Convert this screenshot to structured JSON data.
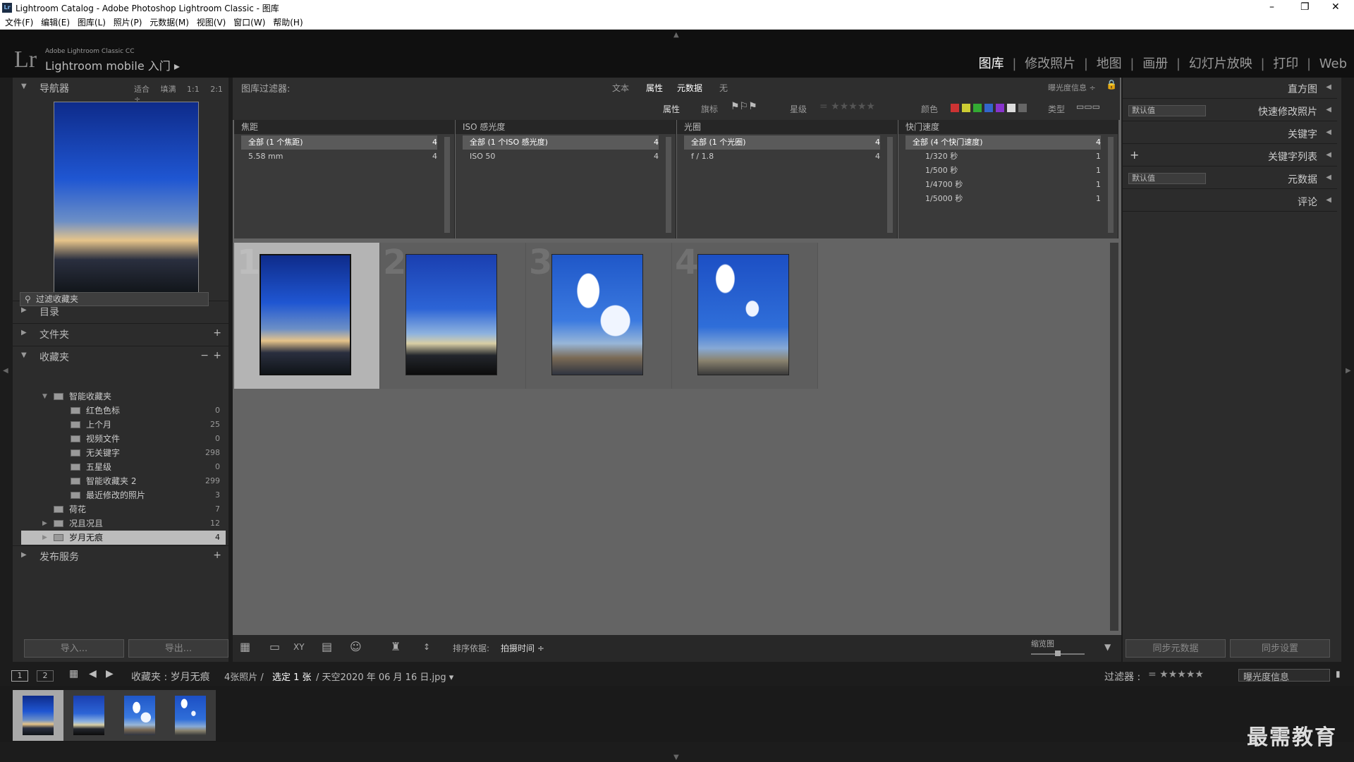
{
  "window": {
    "title": "Lightroom Catalog - Adobe Photoshop Lightroom Classic - 图库"
  },
  "menu": [
    "文件(F)",
    "编辑(E)",
    "图库(L)",
    "照片(P)",
    "元数据(M)",
    "视图(V)",
    "窗口(W)",
    "帮助(H)"
  ],
  "identity": {
    "brand_small": "Adobe Lightroom Classic CC",
    "brand_main": "Lightroom mobile 入门 ▸",
    "lr": "Lr"
  },
  "modules": [
    "图库",
    "修改照片",
    "地图",
    "画册",
    "幻灯片放映",
    "打印",
    "Web"
  ],
  "navigator": {
    "title": "导航器",
    "modes": [
      "适合",
      "填满",
      "1:1",
      "2:1 ÷"
    ]
  },
  "left_panels": {
    "catalog": "目录",
    "folders": "文件夹",
    "collections": "收藏夹",
    "publish": "发布服务"
  },
  "collection_filter": "过滤收藏夹",
  "collections": [
    {
      "label": "智能收藏夹",
      "count": "",
      "indent": 1,
      "type": "set"
    },
    {
      "label": "红色色标",
      "count": "0",
      "indent": 2,
      "type": "smart"
    },
    {
      "label": "上个月",
      "count": "25",
      "indent": 2,
      "type": "smart"
    },
    {
      "label": "视频文件",
      "count": "0",
      "indent": 2,
      "type": "smart"
    },
    {
      "label": "无关键字",
      "count": "298",
      "indent": 2,
      "type": "smart"
    },
    {
      "label": "五星级",
      "count": "0",
      "indent": 2,
      "type": "smart"
    },
    {
      "label": "智能收藏夹 2",
      "count": "299",
      "indent": 2,
      "type": "smart"
    },
    {
      "label": "最近修改的照片",
      "count": "3",
      "indent": 2,
      "type": "smart"
    },
    {
      "label": "荷花",
      "count": "7",
      "indent": 1,
      "type": "coll"
    },
    {
      "label": "况且况且",
      "count": "12",
      "indent": 1,
      "type": "coll"
    },
    {
      "label": "岁月无痕",
      "count": "4",
      "indent": 1,
      "type": "coll"
    }
  ],
  "left_buttons": {
    "import": "导入...",
    "export": "导出..."
  },
  "filterbar": {
    "title": "图库过滤器:",
    "tabs": [
      "文本",
      "属性",
      "元数据",
      "无"
    ],
    "preset": "曝光度信息 ÷",
    "attr_label": "属性",
    "flag": "旗标",
    "rating": "星级",
    "color": "颜色",
    "kind": "类型"
  },
  "metadata_columns": [
    {
      "header": "焦距",
      "rows": [
        {
          "label": "全部 (1 个焦距)",
          "count": "4"
        },
        {
          "label": "5.58 mm",
          "count": "4"
        }
      ]
    },
    {
      "header": "ISO 感光度",
      "rows": [
        {
          "label": "全部 (1 个ISO 感光度)",
          "count": "4"
        },
        {
          "label": "ISO 50",
          "count": "4"
        }
      ]
    },
    {
      "header": "光圈",
      "rows": [
        {
          "label": "全部 (1 个光圈)",
          "count": "4"
        },
        {
          "label": "f / 1.8",
          "count": "4"
        }
      ]
    },
    {
      "header": "快门速度",
      "rows": [
        {
          "label": "全部 (4 个快门速度)",
          "count": "4"
        },
        {
          "label": "1/320 秒",
          "count": "1"
        },
        {
          "label": "1/500 秒",
          "count": "1"
        },
        {
          "label": "1/4700 秒",
          "count": "1"
        },
        {
          "label": "1/5000 秒",
          "count": "1"
        }
      ]
    }
  ],
  "grid": [
    {
      "num": "1"
    },
    {
      "num": "2"
    },
    {
      "num": "3"
    },
    {
      "num": "4"
    }
  ],
  "toolbar": {
    "sort_label": "排序依据:",
    "sort_value": "拍摄时间 ÷",
    "thumb_label": "缩览图"
  },
  "right_panels": {
    "histogram": "直方图",
    "quick_develop": "快速修改照片",
    "keywording": "关键字",
    "keyword_list": "关键字列表",
    "metadata": "元数据",
    "comments": "评论",
    "default1": "默认值",
    "default2": "默认值",
    "plus": "+"
  },
  "right_buttons": {
    "sync_meta": "同步元数据",
    "sync_settings": "同步设置"
  },
  "filmstrip": {
    "view1": "1",
    "view2": "2",
    "source": "收藏夹 : 岁月无痕",
    "count": "4张照片 /",
    "selected": "选定 1 张",
    "file": "/ 天空2020 年 06 月 16 日.jpg ▾",
    "filter_label": "过滤器 :",
    "filter_eq": "= ★★★★★",
    "filter_preset": "曝光度信息"
  },
  "watermark": "最需教育"
}
